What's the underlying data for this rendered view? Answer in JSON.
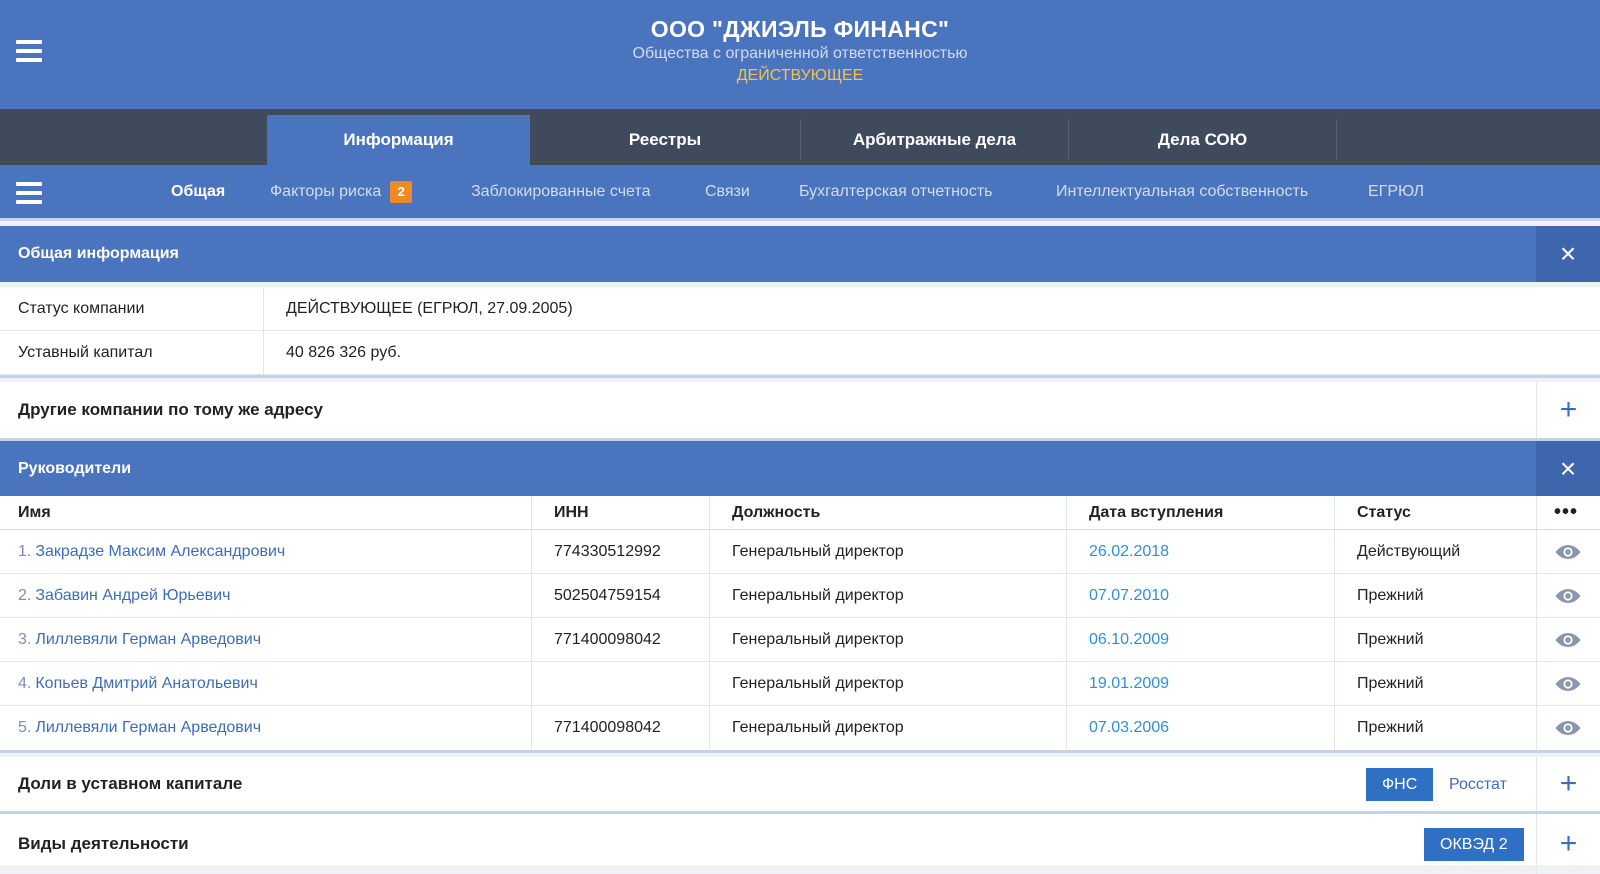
{
  "header": {
    "title": "ООО \"ДЖИЭЛЬ ФИНАНС\"",
    "subtitle": "Общества с ограниченной ответственностью",
    "status": "ДЕЙСТВУЮЩЕЕ"
  },
  "tabs": [
    {
      "label": "Информация",
      "active": true
    },
    {
      "label": "Реестры"
    },
    {
      "label": "Арбитражные дела"
    },
    {
      "label": "Дела СОЮ"
    }
  ],
  "subnav": {
    "items": [
      {
        "label": "Общая",
        "active": true
      },
      {
        "label": "Факторы риска",
        "badge": "2"
      },
      {
        "label": "Заблокированные счета"
      },
      {
        "label": "Связи"
      },
      {
        "label": "Бухгалтерская отчетность"
      },
      {
        "label": "Интеллектуальная собственность"
      },
      {
        "label": "ЕГРЮЛ"
      }
    ]
  },
  "general": {
    "title": "Общая информация",
    "close_icon": "×",
    "rows": [
      {
        "key": "Статус компании",
        "value": "ДЕЙСТВУЮЩЕЕ (ЕГРЮЛ, 27.09.2005)"
      },
      {
        "key": "Уставный капитал",
        "value": "40 826 326 руб."
      }
    ]
  },
  "same_address": {
    "title": "Другие компании по тому же адресу",
    "plus_icon": "+"
  },
  "managers": {
    "title": "Руководители",
    "close_icon": "×",
    "columns": {
      "name": "Имя",
      "inn": "ИНН",
      "position": "Должность",
      "date": "Дата вступления",
      "status": "Статус",
      "more": "•••"
    },
    "rows": [
      {
        "num": "1.",
        "name": "Закрадзе Максим Александрович",
        "inn": "774330512992",
        "position": "Генеральный директор",
        "date": "26.02.2018",
        "status": "Действующий"
      },
      {
        "num": "2.",
        "name": "Забавин Андрей Юрьевич",
        "inn": "502504759154",
        "position": "Генеральный директор",
        "date": "07.07.2010",
        "status": "Прежний"
      },
      {
        "num": "3.",
        "name": "Лиллевяли Герман Арведович",
        "inn": "771400098042",
        "position": "Генеральный директор",
        "date": "06.10.2009",
        "status": "Прежний"
      },
      {
        "num": "4.",
        "name": "Копьев Дмитрий Анатольевич",
        "inn": "",
        "position": "Генеральный директор",
        "date": "19.01.2009",
        "status": "Прежний"
      },
      {
        "num": "5.",
        "name": "Лиллевяли Герман Арведович",
        "inn": "771400098042",
        "position": "Генеральный директор",
        "date": "07.03.2006",
        "status": "Прежний"
      }
    ]
  },
  "shares": {
    "title": "Доли в уставном капитале",
    "chip_fns": "ФНС",
    "chip_rosstat": "Росстат",
    "plus_icon": "+"
  },
  "activities": {
    "title": "Виды деятельности",
    "chip_okved": "ОКВЭД 2",
    "plus_icon": "+"
  },
  "colors": {
    "header_blue": "#4a74bd",
    "tabs_dark": "#3f4a5c",
    "badge_orange": "#f08a24",
    "status_yellow": "#f6c343",
    "link_blue": "#3d6db8"
  }
}
